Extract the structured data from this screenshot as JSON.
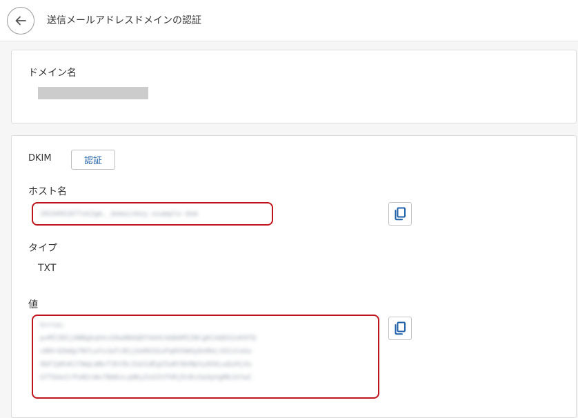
{
  "header": {
    "title": "送信メールアドレスドメインの認証",
    "back_icon": "arrow-left-icon"
  },
  "domain_card": {
    "label": "ドメイン名",
    "value_masked": true
  },
  "dkim_card": {
    "section_label": "DKIM",
    "verify_button_label": "認証",
    "host_label": "ホスト名",
    "host_value_blurred": "20240918f7xk2gm._domainkey.example-dom",
    "type_label": "タイプ",
    "type_value": "TXT",
    "value_label": "値",
    "value_lines_blurred": [
      "k=rsa;",
      "p=MIIBIjANBgkqhkiG9w0BAQEFAAOCAQ8AMIIBCgKCAQEA2xK9fQ",
      "v8HrdZmQp7NfLwYs3aTcB1jUeRk5GxPq0VhW4yDnMoLt6IzCeAs",
      "9bF2pRxKJ7WqLmNvT3hY8cZoU1dEgS5aRtBnMpVy0XkLwQzHj4s",
      "GfT6AeIrPoN2cWx7BmDvLq9KyZsU3tFhRjEn8iOaXpVgMb1kYwC"
    ],
    "copy_icon": "copy-icon",
    "highlight_color": "#c0141c",
    "link_color": "#1f5fa8"
  }
}
